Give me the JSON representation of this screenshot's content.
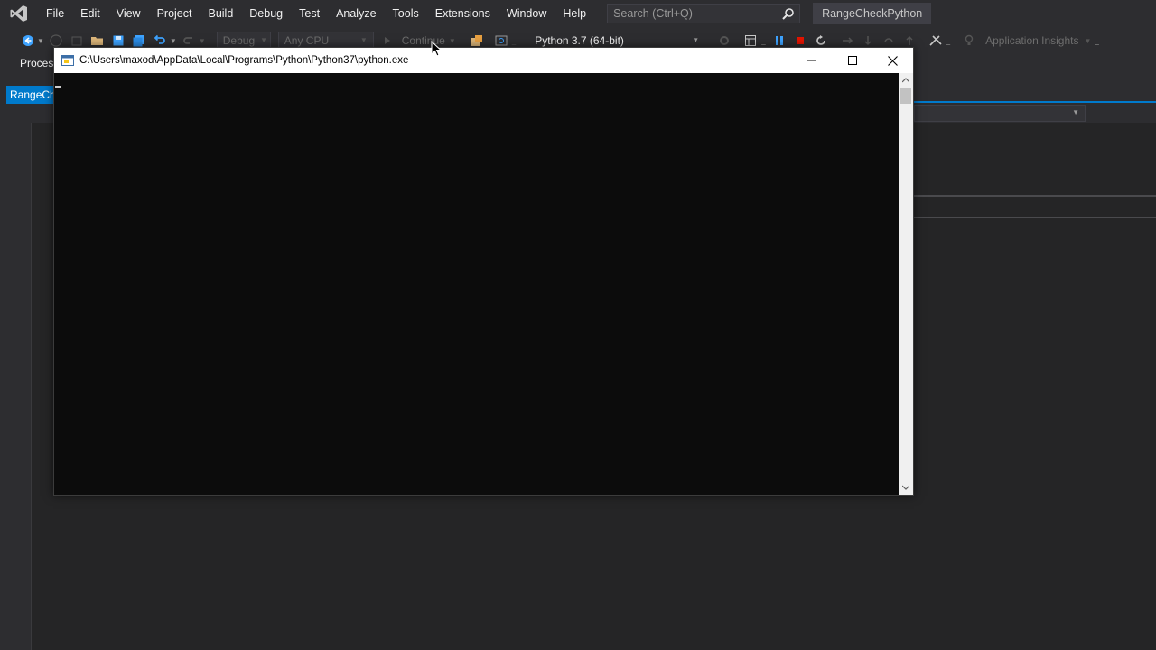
{
  "menu": {
    "items": [
      "File",
      "Edit",
      "View",
      "Project",
      "Build",
      "Debug",
      "Test",
      "Analyze",
      "Tools",
      "Extensions",
      "Window",
      "Help"
    ],
    "search_placeholder": "Search (Ctrl+Q)",
    "project_name": "RangeCheckPython"
  },
  "toolbar": {
    "config": "Debug",
    "platform": "Any CPU",
    "continue_label": "Continue",
    "interpreter": "Python 3.7 (64-bit)",
    "insights": "Application Insights"
  },
  "second_row": {
    "process_label": "Proces",
    "tab_label": "RangeCh"
  },
  "console": {
    "title": "C:\\Users\\maxod\\AppData\\Local\\Programs\\Python\\Python37\\python.exe"
  },
  "colors": {
    "accent": "#007acc",
    "ide_bg": "#2d2d30",
    "console_bg": "#0c0c0c",
    "stop_red": "#e51400",
    "pause_blue": "#3ea3ff"
  },
  "icons": [
    "vs-logo-icon",
    "back-icon",
    "forward-icon",
    "new-project-icon",
    "open-folder-icon",
    "save-icon",
    "save-all-icon",
    "undo-icon",
    "redo-icon",
    "start-icon",
    "search-icon",
    "pause-icon",
    "stop-icon",
    "restart-icon",
    "python-icon",
    "minimize-icon",
    "maximize-icon",
    "close-icon"
  ]
}
